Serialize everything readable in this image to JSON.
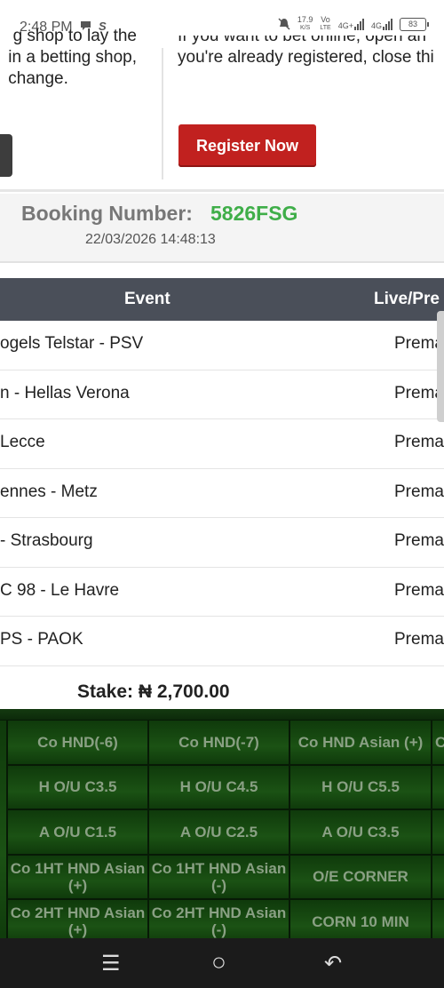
{
  "status_bar": {
    "time": "2:48 PM",
    "notification_icons": [
      "chat-icon",
      "s-icon"
    ],
    "speed": "17.9",
    "speed_unit": "K/S",
    "net1": "Vo",
    "net1_sub": "LTE",
    "net2": "4G+",
    "net3": "4G",
    "battery": "83"
  },
  "info": {
    "left_lines": [
      "g shop to lay the",
      "in a betting shop,",
      "change."
    ],
    "right_lines": [
      "If you want to bet online, open an",
      "you're already registered, close thi"
    ],
    "register_button": "Register Now"
  },
  "booking": {
    "label": "Booking Number:",
    "code": "5826FSG",
    "date": "22/03/2026 14:48:13",
    "code_color": "#3fae49"
  },
  "table": {
    "headers": {
      "event": "Event",
      "live": "Live/Pre"
    },
    "rows": [
      {
        "event": "ogels Telstar - PSV",
        "status": "Prema"
      },
      {
        "event": "n - Hellas Verona",
        "status": "Prema"
      },
      {
        "event": "Lecce",
        "status": "Prema"
      },
      {
        "event": "ennes - Metz",
        "status": "Prema"
      },
      {
        "event": "- Strasbourg",
        "status": "Prema"
      },
      {
        "event": "C 98 - Le Havre",
        "status": "Prema"
      },
      {
        "event": "PS - PAOK",
        "status": "Prema"
      }
    ]
  },
  "stake": "Stake: ₦ 2,700.00",
  "markets": [
    [
      "Co HND(-6)",
      "Co HND(-7)",
      "Co HND Asian (+)",
      "C"
    ],
    [
      "H O/U C3.5",
      "H O/U C4.5",
      "H O/U C5.5",
      ""
    ],
    [
      "A O/U C1.5",
      "A O/U C2.5",
      "A O/U C3.5",
      ""
    ],
    [
      "Co 1HT HND Asian (+)",
      "Co 1HT HND Asian (-)",
      "O/E CORNER",
      ""
    ],
    [
      "Co 2HT HND Asian (+)",
      "Co 2HT HND Asian (-)",
      "CORN 10 MIN",
      ""
    ]
  ],
  "nav": {
    "recent": "☰",
    "home": "○",
    "back": "↶"
  },
  "colors": {
    "register": "#c1211f",
    "table_header": "#4a4f59",
    "market_bg": "#1b5214"
  }
}
